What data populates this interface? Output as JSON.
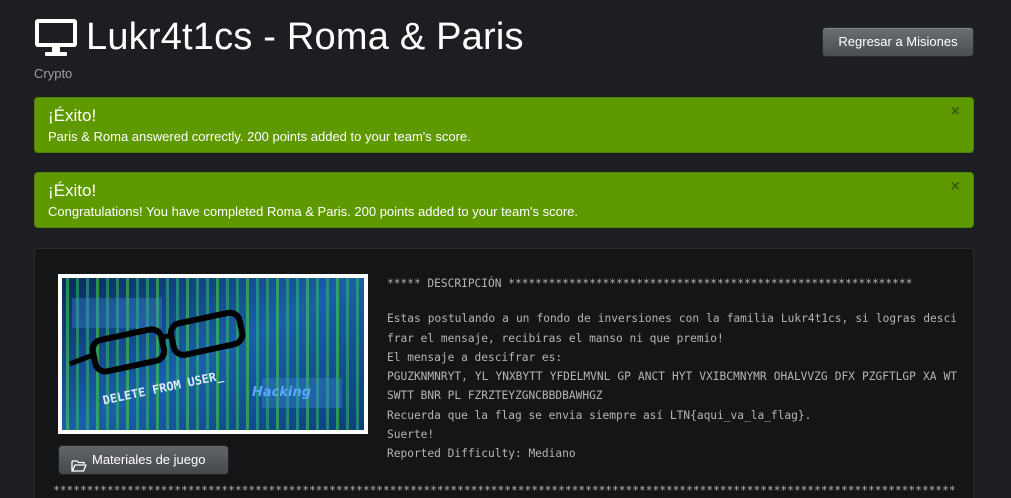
{
  "header": {
    "title": "Lukr4t1cs - Roma & Paris",
    "category": "Crypto",
    "back_button_label": "Regresar a Misiones"
  },
  "alerts": [
    {
      "heading": "¡Éxito!",
      "text": "Paris & Roma answered correctly. 200 points added to your team's score.",
      "close": "×"
    },
    {
      "heading": "¡Éxito!",
      "text": "Congratulations! You have completed Roma & Paris. 200 points added to your team's score.",
      "close": "×"
    }
  ],
  "challenge": {
    "image": {
      "banner_text": "DELETE FROM USER_",
      "badge_text": "Hacking"
    },
    "materials_button_label": "Materiales de juego",
    "description_header": "***** DESCRIPCIÓN ************************************************************",
    "intro": "Estas postulando a un fondo de inversiones con la familia Lukr4t1cs, si logras descifrar el mensaje, recibiras el manso ni que premio!",
    "message_label": "El mensaje a descifrar es:",
    "cipher_text": "PGUZKNMNRYT, YL YNXBYTT YFDELMVNL GP ANCT HYT VXIBCMNYMR OHALVVZG DFX PZGFTLGP XA WT SWTT BNR PL FZRZTEYZGNCBBDBAWHGZ",
    "flag_hint": "Recuerda que la flag se envia siempre así LTN{aqui_va_la_flag}.",
    "farewell": "Suerte!",
    "difficulty": "Reported Difficulty: Mediano",
    "bottom_rule": "**************************************************************************************************************************************"
  },
  "colors": {
    "background": "#1c1e22",
    "success": "#5e9900",
    "panel": "#141517"
  },
  "icons": {
    "title_icon": "monitor-icon",
    "materials_icon": "folder-open-icon",
    "alert_close": "close-icon"
  }
}
